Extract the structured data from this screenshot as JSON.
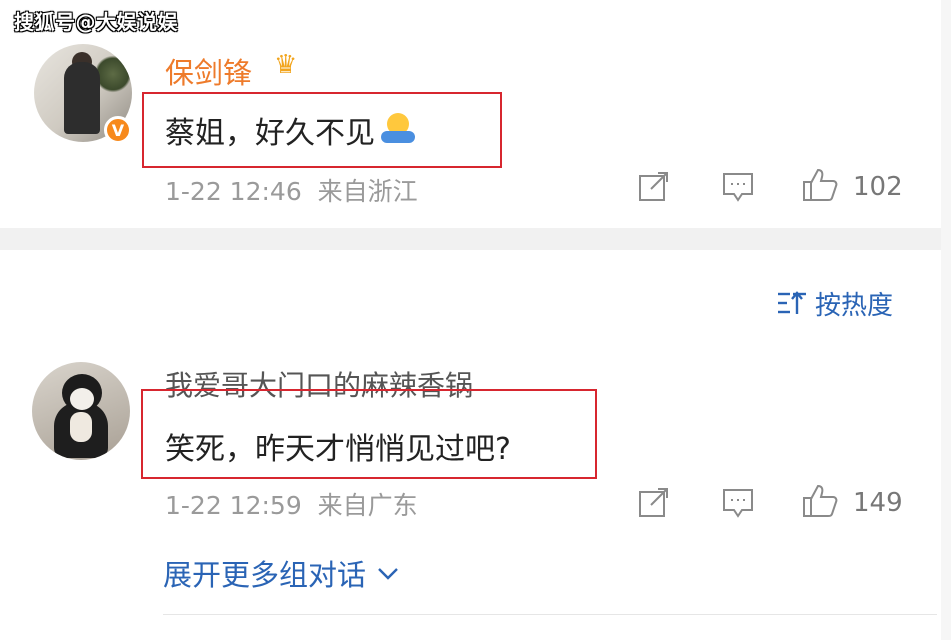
{
  "watermark": "搜狐号@大娱说娱",
  "comments": [
    {
      "username": "保剑锋",
      "text": "蔡姐，好久不见",
      "time": "1-22 12:46",
      "location": "来自浙江",
      "likes": "102",
      "badge_icon": "verified-v-icon",
      "username_color": "#ee7b2b"
    },
    {
      "username": "我爱哥大门口的麻辣香锅",
      "text": "笑死，昨天才悄悄见过吧?",
      "time": "1-22 12:59",
      "location": "来自广东",
      "likes": "149"
    }
  ],
  "sort": {
    "label": "按热度"
  },
  "expand": {
    "label": "展开更多组对话"
  },
  "colors": {
    "link": "#2a64b5",
    "highlight_box": "#d7262f",
    "verified": "#f7891c"
  }
}
